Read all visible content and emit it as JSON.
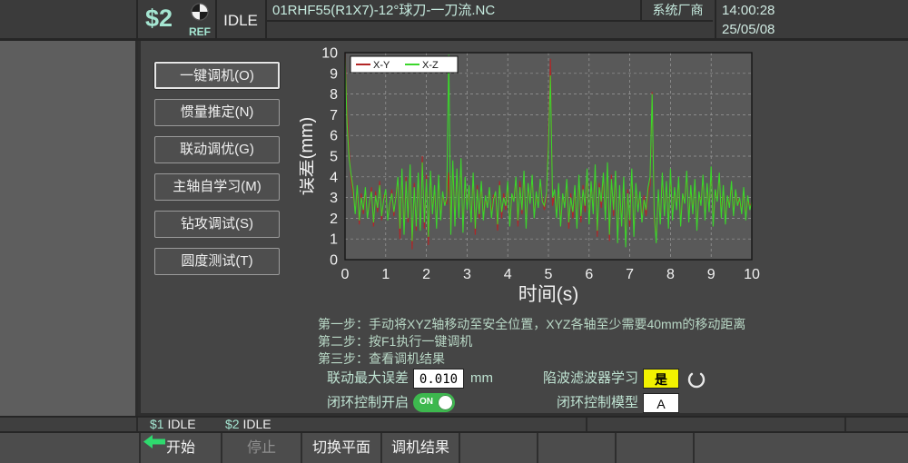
{
  "top_bar": {
    "channel": "$2",
    "ref_label": "REF",
    "mode": "IDLE",
    "program_title": "01RHF55(R1X7)-12°球刀-一刀流.NC",
    "vendor": "系统厂商",
    "time": "14:00:28",
    "date": "25/05/08"
  },
  "sidebar": {
    "buttons": [
      {
        "label": "一键调机(O)",
        "active": true
      },
      {
        "label": "惯量推定(N)",
        "active": false
      },
      {
        "label": "联动调优(G)",
        "active": false
      },
      {
        "label": "主轴自学习(M)",
        "active": false
      },
      {
        "label": "钻攻调试(S)",
        "active": false
      },
      {
        "label": "圆度测试(T)",
        "active": false
      }
    ]
  },
  "chart_data": {
    "type": "line",
    "title": "",
    "xlabel": "时间(s)",
    "ylabel": "误差(mm)",
    "xlim": [
      0,
      10
    ],
    "ylim": [
      0,
      10
    ],
    "x_ticks": [
      0,
      1,
      2,
      3,
      4,
      5,
      6,
      7,
      8,
      9,
      10
    ],
    "y_ticks": [
      0,
      1,
      2,
      3,
      4,
      5,
      6,
      7,
      8,
      9,
      10
    ],
    "grid": true,
    "legend_position": "upper-left",
    "plot_bg": "#595959",
    "x_start": 0,
    "x_step": 0.05,
    "series": [
      {
        "name": "X-Y",
        "color": "#b22626",
        "values": [
          10.0,
          7.3,
          5.3,
          3.8,
          3.1,
          2.4,
          3.3,
          1.7,
          3.2,
          2.2,
          3.2,
          2.2,
          2.6,
          3.5,
          1.6,
          3.3,
          2.3,
          3.8,
          1.9,
          3.1,
          3.1,
          2.1,
          2.5,
          3.4,
          2.1,
          3.2,
          3.7,
          1.0,
          4.1,
          1.5,
          4.0,
          1.8,
          4.3,
          0.5,
          3.7,
          1.4,
          3.9,
          1.6,
          5.0,
          1.5,
          4.1,
          0.7,
          4.0,
          2.4,
          3.3,
          1.8,
          3.8,
          2.1,
          3.0,
          2.8,
          2.7,
          4.2,
          1.5,
          4.5,
          1.9,
          4.1,
          2.3,
          4.6,
          1.6,
          3.7,
          2.6,
          3.3,
          2.1,
          3.9,
          1.2,
          3.6,
          2.0,
          3.5,
          2.2,
          2.8,
          2.7,
          3.2,
          2.3,
          3.1,
          3.0,
          1.4,
          3.8,
          2.0,
          3.2,
          2.4,
          3.5,
          1.9,
          3.0,
          3.0,
          3.7,
          1.6,
          3.8,
          2.2,
          4.0,
          1.8,
          3.4,
          2.9,
          3.8,
          2.3,
          3.0,
          2.7,
          3.6,
          3.0,
          2.4,
          3.0,
          6.0,
          9.7,
          2.6,
          3.1,
          2.3,
          3.4,
          1.9,
          3.0,
          2.7,
          3.6,
          1.5,
          3.2,
          2.0,
          3.3,
          1.8,
          3.8,
          1.8,
          3.6,
          2.3,
          4.1,
          2.0,
          3.5,
          2.5,
          4.2,
          1.1,
          3.7,
          2.5,
          3.9,
          2.2,
          4.4,
          0.9,
          4.1,
          2.1,
          4.0,
          1.2,
          3.3,
          1.9,
          3.7,
          1.0,
          3.4,
          1.6,
          4.1,
          1.4,
          3.4,
          2.6,
          3.0,
          2.1,
          3.1,
          2.1,
          3.2,
          3.6,
          8.1,
          1.9,
          1.2,
          3.1,
          2.0,
          3.9,
          2.4,
          3.5,
          1.8,
          4.1,
          2.2,
          3.2,
          2.7,
          3.7,
          1.9,
          2.9,
          3.0,
          4.0,
          2.1,
          3.3,
          2.5,
          3.6,
          1.7,
          3.0,
          2.9,
          3.8,
          2.2,
          3.4,
          2.6,
          4.2,
          1.9,
          3.1,
          3.1,
          3.9,
          2.3,
          3.3,
          2.0,
          2.8,
          2.8,
          3.5,
          2.4,
          3.1,
          2.9,
          2.7,
          2.5,
          3.2,
          2.2,
          2.8,
          2.7,
          2.5
        ]
      },
      {
        "name": "X-Z",
        "color": "#3bd62c",
        "values": [
          9.8,
          6.6,
          4.9,
          4.1,
          3.4,
          2.2,
          3.6,
          1.9,
          3.0,
          2.4,
          3.5,
          2.0,
          2.8,
          3.3,
          1.8,
          3.1,
          2.5,
          3.6,
          2.1,
          2.9,
          3.4,
          1.9,
          2.7,
          3.2,
          2.3,
          3.0,
          4.0,
          1.5,
          4.4,
          1.2,
          3.8,
          2.0,
          4.6,
          0.9,
          3.5,
          1.6,
          4.2,
          1.4,
          4.7,
          1.8,
          3.9,
          1.1,
          4.3,
          2.2,
          3.6,
          1.5,
          4.1,
          1.9,
          3.3,
          2.6,
          3.0,
          9.9,
          1.2,
          4.8,
          1.6,
          4.4,
          2.0,
          4.9,
          1.3,
          4.0,
          2.4,
          3.6,
          1.8,
          4.2,
          1.5,
          3.4,
          2.2,
          3.8,
          1.9,
          3.1,
          2.5,
          3.5,
          2.0,
          2.9,
          3.3,
          1.7,
          3.6,
          2.3,
          3.0,
          2.6,
          3.8,
          1.6,
          3.2,
          2.8,
          4.0,
          1.9,
          3.5,
          2.4,
          4.3,
          1.5,
          3.7,
          2.7,
          4.1,
          2.0,
          3.3,
          2.5,
          3.9,
          2.8,
          2.6,
          3.2,
          5.5,
          8.9,
          3.0,
          3.4,
          2.0,
          3.7,
          1.6,
          3.2,
          2.5,
          3.9,
          1.8,
          3.0,
          2.3,
          3.6,
          1.5,
          4.1,
          2.1,
          3.4,
          2.6,
          4.4,
          1.7,
          3.8,
          2.2,
          4.6,
          1.4,
          3.5,
          2.8,
          4.2,
          1.9,
          4.7,
          1.2,
          3.9,
          2.4,
          4.3,
          0.8,
          3.6,
          1.6,
          4.0,
          0.6,
          3.2,
          1.9,
          4.4,
          1.1,
          3.7,
          2.3,
          3.3,
          1.8,
          2.9,
          2.4,
          3.5,
          4.0,
          8.0,
          2.2,
          0.8,
          3.4,
          1.7,
          4.2,
          2.1,
          3.8,
          1.5,
          4.4,
          1.9,
          3.5,
          2.4,
          4.0,
          1.6,
          3.2,
          2.7,
          4.3,
          1.8,
          3.6,
          2.2,
          3.9,
          1.4,
          3.3,
          2.6,
          4.1,
          1.9,
          3.7,
          2.3,
          4.5,
          1.6,
          3.4,
          2.8,
          4.2,
          2.0,
          3.6,
          1.7,
          3.1,
          2.5,
          3.8,
          2.1,
          3.4,
          2.6,
          3.0,
          2.2,
          3.5,
          1.9,
          3.1,
          2.4,
          2.8
        ]
      }
    ]
  },
  "instructions": {
    "step1": "第一步：手动将XYZ轴移动至安全位置，XYZ各轴至少需要40mm的移动距离",
    "step2": "第二步：按F1执行一键调机",
    "step3": "第三步：查看调机结果"
  },
  "form": {
    "max_error_label": "联动最大误差",
    "max_error_value": "0.010",
    "max_error_unit": "mm",
    "notch_label": "陷波滤波器学习",
    "notch_value": "是",
    "closed_loop_label": "闭环控制开启",
    "closed_loop_state": "ON",
    "model_label": "闭环控制模型",
    "model_value": "A"
  },
  "status_bar": {
    "ch1_id": "$1",
    "ch1_state": "IDLE",
    "ch2_id": "$2",
    "ch2_state": "IDLE"
  },
  "softkeys": [
    {
      "label": "开始",
      "enabled": true
    },
    {
      "label": "停止",
      "enabled": false
    },
    {
      "label": "切换平面",
      "enabled": true
    },
    {
      "label": "调机结果",
      "enabled": true
    }
  ],
  "colors": {
    "accent_teal": "#a5e6d2",
    "toggle_green": "#3db84e",
    "notch_yellow": "#f2f200",
    "arrow_green": "#2fd96e"
  }
}
